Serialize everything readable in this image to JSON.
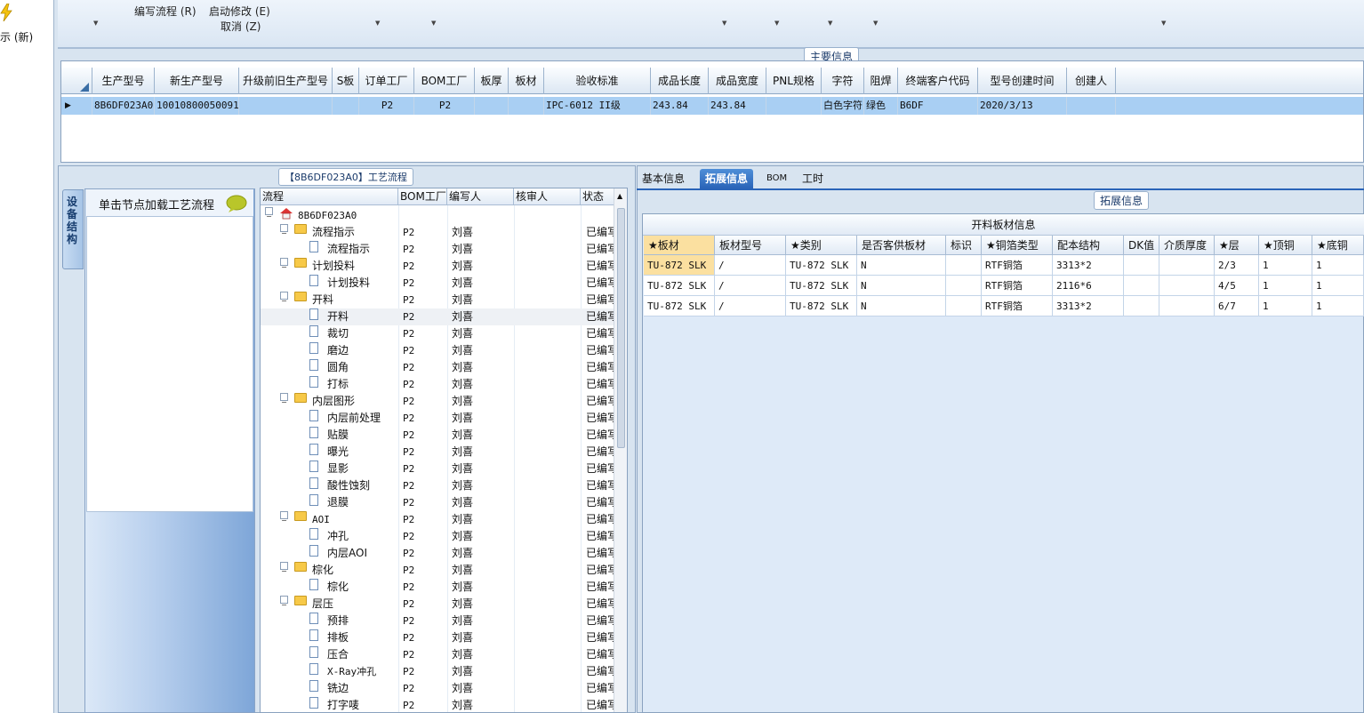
{
  "left_strip": {
    "label": "示 (新)"
  },
  "toolbar": {
    "items": [
      {
        "label": "编写流程 (R)"
      },
      {
        "label": "启动修改 (E)"
      },
      {
        "label": "取消 (Z)"
      }
    ]
  },
  "main_info": {
    "group_label": "主要信息",
    "columns": [
      "生产型号",
      "新生产型号",
      "升级前旧生产型号",
      "S板",
      "订单工厂",
      "BOM工厂",
      "板厚",
      "板材",
      "验收标准",
      "成品长度",
      "成品宽度",
      "PNL规格",
      "字符",
      "阻焊",
      "终端客户代码",
      "型号创建时间",
      "创建人"
    ],
    "row": [
      "8B6DF023A0",
      "10010800050091",
      "",
      "",
      "P2",
      "P2",
      "",
      "",
      "IPC-6012 II级",
      "243.84",
      "243.84",
      "",
      "白色字符",
      "绿色",
      "B6DF",
      "2020/3/13",
      ""
    ]
  },
  "process": {
    "group_label": "【8B6DF023A0】工艺流程",
    "side_tab": "设备结构",
    "load_hint": "单击节点加载工艺流程",
    "columns": [
      "流程",
      "BOM工厂",
      "编写人",
      "核审人",
      "状态"
    ],
    "root": "8B6DF023A0",
    "rows": [
      {
        "name": "流程指示",
        "level": 1,
        "type": "folder",
        "bom": "P2",
        "author": "刘喜",
        "status": "已编写"
      },
      {
        "name": "流程指示",
        "level": 2,
        "type": "doc",
        "bom": "P2",
        "author": "刘喜",
        "status": "已编写"
      },
      {
        "name": "计划投料",
        "level": 1,
        "type": "folder",
        "bom": "P2",
        "author": "刘喜",
        "status": "已编写"
      },
      {
        "name": "计划投料",
        "level": 2,
        "type": "doc",
        "bom": "P2",
        "author": "刘喜",
        "status": "已编写"
      },
      {
        "name": "开料",
        "level": 1,
        "type": "folder",
        "bom": "P2",
        "author": "刘喜",
        "status": "已编写"
      },
      {
        "name": "开料",
        "level": 2,
        "type": "doc",
        "bom": "P2",
        "author": "刘喜",
        "status": "已编写"
      },
      {
        "name": "裁切",
        "level": 2,
        "type": "doc",
        "bom": "P2",
        "author": "刘喜",
        "status": "已编写"
      },
      {
        "name": "磨边",
        "level": 2,
        "type": "doc",
        "bom": "P2",
        "author": "刘喜",
        "status": "已编写"
      },
      {
        "name": "圆角",
        "level": 2,
        "type": "doc",
        "bom": "P2",
        "author": "刘喜",
        "status": "已编写"
      },
      {
        "name": "打标",
        "level": 2,
        "type": "doc",
        "bom": "P2",
        "author": "刘喜",
        "status": "已编写"
      },
      {
        "name": "内层图形",
        "level": 1,
        "type": "folder",
        "bom": "P2",
        "author": "刘喜",
        "status": "已编写"
      },
      {
        "name": "内层前处理",
        "level": 2,
        "type": "doc",
        "bom": "P2",
        "author": "刘喜",
        "status": "已编写"
      },
      {
        "name": "贴膜",
        "level": 2,
        "type": "doc",
        "bom": "P2",
        "author": "刘喜",
        "status": "已编写"
      },
      {
        "name": "曝光",
        "level": 2,
        "type": "doc",
        "bom": "P2",
        "author": "刘喜",
        "status": "已编写"
      },
      {
        "name": "显影",
        "level": 2,
        "type": "doc",
        "bom": "P2",
        "author": "刘喜",
        "status": "已编写"
      },
      {
        "name": "酸性蚀刻",
        "level": 2,
        "type": "doc",
        "bom": "P2",
        "author": "刘喜",
        "status": "已编写"
      },
      {
        "name": "退膜",
        "level": 2,
        "type": "doc",
        "bom": "P2",
        "author": "刘喜",
        "status": "已编写"
      },
      {
        "name": "AOI",
        "level": 1,
        "type": "folder",
        "bom": "P2",
        "author": "刘喜",
        "status": "已编写"
      },
      {
        "name": "冲孔",
        "level": 2,
        "type": "doc",
        "bom": "P2",
        "author": "刘喜",
        "status": "已编写"
      },
      {
        "name": "内层AOI",
        "level": 2,
        "type": "doc",
        "bom": "P2",
        "author": "刘喜",
        "status": "已编写"
      },
      {
        "name": "棕化",
        "level": 1,
        "type": "folder",
        "bom": "P2",
        "author": "刘喜",
        "status": "已编写"
      },
      {
        "name": "棕化",
        "level": 2,
        "type": "doc",
        "bom": "P2",
        "author": "刘喜",
        "status": "已编写"
      },
      {
        "name": "层压",
        "level": 1,
        "type": "folder",
        "bom": "P2",
        "author": "刘喜",
        "status": "已编写"
      },
      {
        "name": "预排",
        "level": 2,
        "type": "doc",
        "bom": "P2",
        "author": "刘喜",
        "status": "已编写"
      },
      {
        "name": "排板",
        "level": 2,
        "type": "doc",
        "bom": "P2",
        "author": "刘喜",
        "status": "已编写"
      },
      {
        "name": "压合",
        "level": 2,
        "type": "doc",
        "bom": "P2",
        "author": "刘喜",
        "status": "已编写"
      },
      {
        "name": "X-Ray冲孔",
        "level": 2,
        "type": "doc",
        "bom": "P2",
        "author": "刘喜",
        "status": "已编写"
      },
      {
        "name": "铣边",
        "level": 2,
        "type": "doc",
        "bom": "P2",
        "author": "刘喜",
        "status": "已编写"
      },
      {
        "name": "打字唛",
        "level": 2,
        "type": "doc",
        "bom": "P2",
        "author": "刘喜",
        "status": "已编写"
      }
    ]
  },
  "right": {
    "tabs": [
      "基本信息",
      "拓展信息",
      "BOM",
      "工时"
    ],
    "active_tab": "拓展信息",
    "group_label": "拓展信息",
    "table_title": "开料板材信息",
    "columns": [
      "★板材",
      "板材型号",
      "★类别",
      "是否客供板材",
      "标识",
      "★铜箔类型",
      "配本结构",
      "DK值",
      "介质厚度",
      "★层",
      "★顶铜",
      "★底铜"
    ],
    "rows": [
      [
        "TU-872 SLK",
        "/",
        "TU-872 SLK",
        "N",
        "",
        "RTF铜箔",
        "3313*2",
        "",
        "",
        "2/3",
        "1",
        "1"
      ],
      [
        "TU-872 SLK",
        "/",
        "TU-872 SLK",
        "N",
        "",
        "RTF铜箔",
        "2116*6",
        "",
        "",
        "4/5",
        "1",
        "1"
      ],
      [
        "TU-872 SLK",
        "/",
        "TU-872 SLK",
        "N",
        "",
        "RTF铜箔",
        "3313*2",
        "",
        "",
        "6/7",
        "1",
        "1"
      ]
    ]
  },
  "colors": {
    "selected_row": "#a9cff3",
    "active_tab": "#2a64b8",
    "highlight_cell": "#fbe0a0"
  }
}
